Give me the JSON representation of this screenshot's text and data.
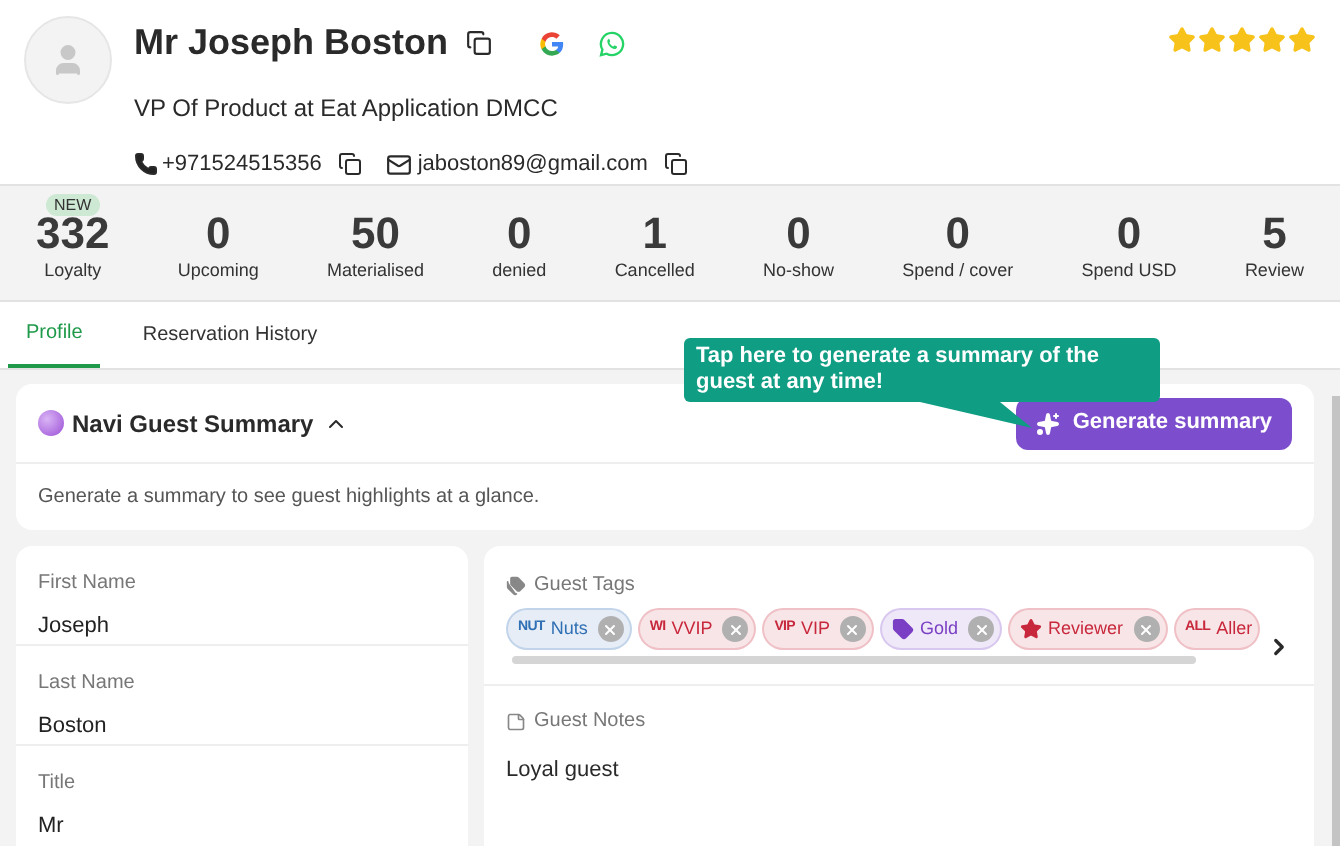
{
  "guest": {
    "name": "Mr Joseph Boston",
    "position": "VP Of Product at Eat Application DMCC",
    "phone": "+971524515356",
    "email": "jaboston89@gmail.com",
    "stars": 5
  },
  "stats": [
    {
      "value": "332",
      "label": "Loyalty",
      "badge": "NEW"
    },
    {
      "value": "0",
      "label": "Upcoming"
    },
    {
      "value": "50",
      "label": "Materialised"
    },
    {
      "value": "0",
      "label": "denied"
    },
    {
      "value": "1",
      "label": "Cancelled"
    },
    {
      "value": "0",
      "label": "No-show"
    },
    {
      "value": "0",
      "label": "Spend / cover"
    },
    {
      "value": "0",
      "label": "Spend USD"
    },
    {
      "value": "5",
      "label": "Review"
    }
  ],
  "tabs": [
    {
      "label": "Profile",
      "selected": true
    },
    {
      "label": "Reservation History",
      "selected": false
    }
  ],
  "tooltip": "Tap here to generate a summary of the guest at any time!",
  "summary": {
    "title": "Navi Guest Summary",
    "expanded": true,
    "button": "Generate summary",
    "hint": "Generate a summary to see guest highlights at a glance."
  },
  "fields": [
    {
      "label": "First Name",
      "value": "Joseph"
    },
    {
      "label": "Last Name",
      "value": "Boston"
    },
    {
      "label": "Title",
      "value": "Mr"
    }
  ],
  "guest_tags": {
    "title": "Guest Tags",
    "tags": [
      {
        "kind": "code",
        "prefix": "NUT",
        "label": "Nuts",
        "color": "#2f6fb3"
      },
      {
        "kind": "code",
        "prefix": "WI",
        "label": "VVIP",
        "color": "#c8283c"
      },
      {
        "kind": "code",
        "prefix": "VIP",
        "label": "VIP",
        "color": "#c8283c"
      },
      {
        "kind": "tag",
        "label": "Gold",
        "color": "#7a3fc4"
      },
      {
        "kind": "star",
        "label": "Reviewer",
        "color": "#c8283c"
      },
      {
        "kind": "code",
        "prefix": "ALL",
        "label": "Aller",
        "color": "#c8283c"
      }
    ]
  },
  "guest_notes": {
    "title": "Guest Notes",
    "text": "Loyal guest"
  }
}
